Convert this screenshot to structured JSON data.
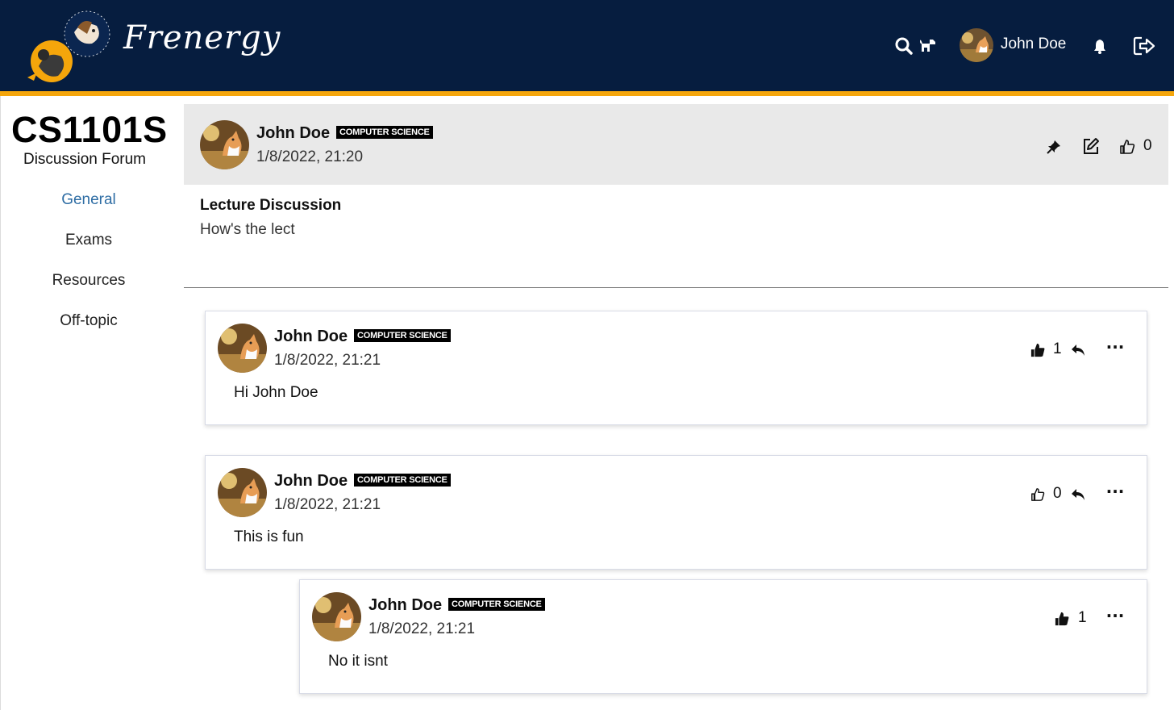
{
  "app": {
    "brand": "Frenergy",
    "colors": {
      "navbar": "#061d3f",
      "accent": "#f5a60b",
      "active_link": "#2e6da4",
      "badge_bg": "#000000"
    }
  },
  "navbar": {
    "icons": [
      "search-icon",
      "dog-icon",
      "bell-icon",
      "logout-icon"
    ],
    "username": "John Doe"
  },
  "sidebar": {
    "course_code": "CS1101S",
    "subtitle": "Discussion Forum",
    "items": [
      {
        "label": "General",
        "active": true
      },
      {
        "label": "Exams",
        "active": false
      },
      {
        "label": "Resources",
        "active": false
      },
      {
        "label": "Off-topic",
        "active": false
      }
    ]
  },
  "post": {
    "author": "John Doe",
    "badge": "COMPUTER SCIENCE",
    "timestamp": "1/8/2022, 21:20",
    "likes": "0",
    "title": "Lecture Discussion",
    "body": "How's the lect",
    "icons": [
      "pin-icon",
      "edit-icon",
      "thumbs-up-outline-icon"
    ]
  },
  "comments": [
    {
      "author": "John Doe",
      "badge": "COMPUTER SCIENCE",
      "timestamp": "1/8/2022, 21:21",
      "text": "Hi John Doe",
      "likes": "1",
      "liked": true,
      "reply": true,
      "menu": "···"
    },
    {
      "author": "John Doe",
      "badge": "COMPUTER SCIENCE",
      "timestamp": "1/8/2022, 21:21",
      "text": "This is fun",
      "likes": "0",
      "liked": false,
      "reply": true,
      "menu": "···"
    },
    {
      "author": "John Doe",
      "badge": "COMPUTER SCIENCE",
      "timestamp": "1/8/2022, 21:21",
      "text": "No it isnt",
      "likes": "1",
      "liked": true,
      "reply": false,
      "menu": "···"
    }
  ]
}
